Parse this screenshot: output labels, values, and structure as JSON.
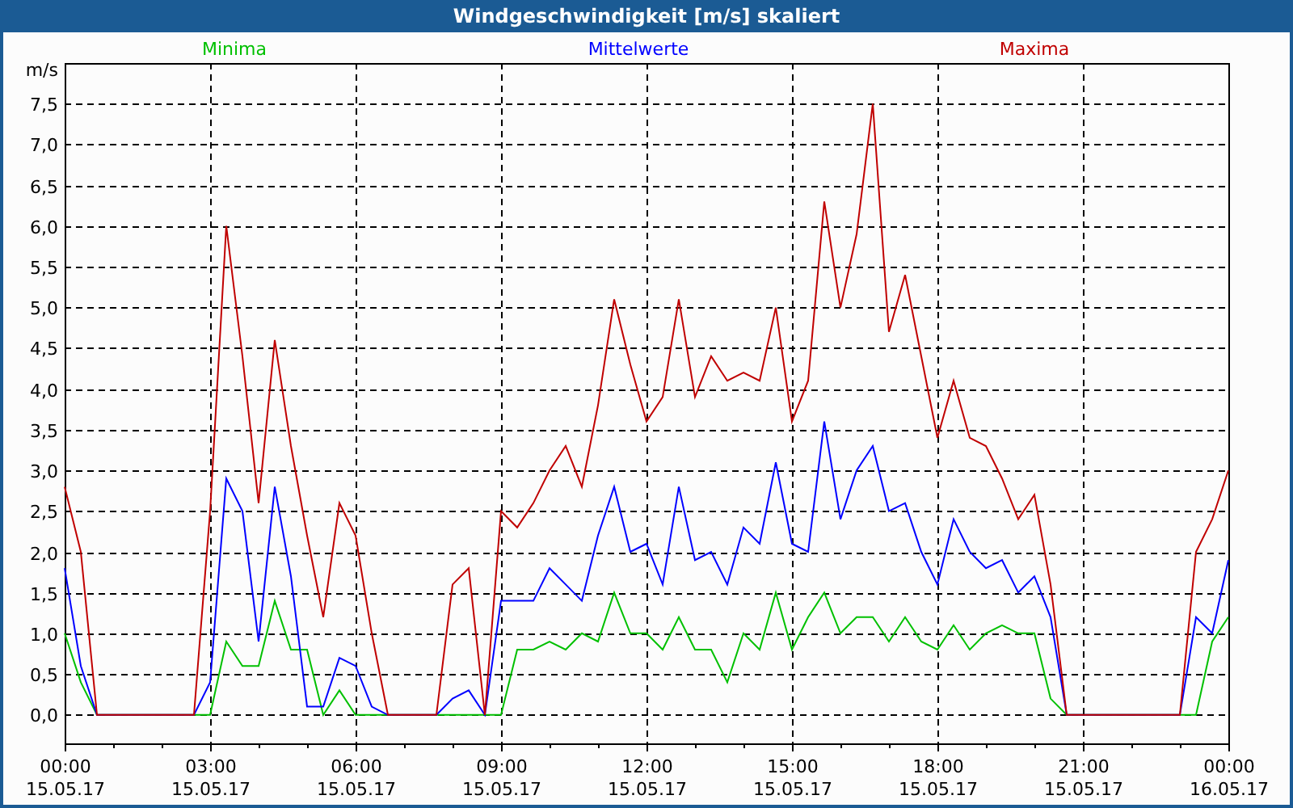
{
  "window": {
    "title": "Windgeschwindigkeit [m/s] skaliert"
  },
  "chart": {
    "chart_data": {
      "type": "line",
      "grid": true,
      "ylabel": "m/s",
      "ylim": [
        -0.35,
        8.0
      ],
      "categories": [
        "00:00 15.05.17",
        null,
        null,
        null,
        null,
        null,
        null,
        null,
        null,
        "03:00 15.05.17",
        null,
        null,
        null,
        null,
        null,
        null,
        null,
        null,
        "06:00 15.05.17",
        null,
        null,
        null,
        null,
        null,
        null,
        null,
        null,
        "09:00 15.05.17",
        null,
        null,
        null,
        null,
        null,
        null,
        null,
        null,
        "12:00 15.05.17",
        null,
        null,
        null,
        null,
        null,
        null,
        null,
        null,
        "15:00 15.05.17",
        null,
        null,
        null,
        null,
        null,
        null,
        null,
        null,
        "18:00 15.05.17",
        null,
        null,
        null,
        null,
        null,
        null,
        null,
        null,
        "21:00 15.05.17",
        null,
        null,
        null,
        null,
        null,
        null,
        null,
        null,
        "00:00 16.05.17"
      ],
      "series": [
        {
          "name": "Minima",
          "color": "#00c000",
          "values": [
            1.0,
            0.4,
            0,
            0,
            0,
            0,
            0,
            0,
            0,
            0,
            0.9,
            0.6,
            0.6,
            1.4,
            0.8,
            0.8,
            0,
            0.3,
            0,
            0,
            0,
            0,
            0,
            0,
            0,
            0,
            0,
            0,
            0.8,
            0.8,
            0.9,
            0.8,
            1.0,
            0.9,
            1.5,
            1.0,
            1.0,
            0.8,
            1.2,
            0.8,
            0.8,
            0.4,
            1.0,
            0.8,
            1.5,
            0.8,
            1.2,
            1.5,
            1.0,
            1.2,
            1.2,
            0.9,
            1.2,
            0.9,
            0.8,
            1.1,
            0.8,
            1.0,
            1.1,
            1.0,
            1.0,
            0.2,
            0,
            0,
            0,
            0,
            0,
            0,
            0,
            0,
            0,
            0.9,
            1.2
          ]
        },
        {
          "name": "Mittelwerte",
          "color": "#0000ff",
          "values": [
            1.8,
            0.6,
            0,
            0,
            0,
            0,
            0,
            0,
            0,
            0.4,
            2.9,
            2.5,
            0.9,
            2.8,
            1.7,
            0.1,
            0.1,
            0.7,
            0.6,
            0.1,
            0,
            0,
            0,
            0,
            0.2,
            0.3,
            0,
            1.4,
            1.4,
            1.4,
            1.8,
            1.6,
            1.4,
            2.2,
            2.8,
            2.0,
            2.1,
            1.6,
            2.8,
            1.9,
            2.0,
            1.6,
            2.3,
            2.1,
            3.1,
            2.1,
            2.0,
            3.6,
            2.4,
            3.0,
            3.3,
            2.5,
            2.6,
            2.0,
            1.6,
            2.4,
            2.0,
            1.8,
            1.9,
            1.5,
            1.7,
            1.2,
            0,
            0,
            0,
            0,
            0,
            0,
            0,
            0,
            1.2,
            1.0,
            1.9
          ]
        },
        {
          "name": "Maxima",
          "color": "#c00000",
          "values": [
            2.8,
            2.0,
            0,
            0,
            0,
            0,
            0,
            0,
            0,
            2.5,
            6.0,
            4.4,
            2.6,
            4.6,
            3.3,
            2.2,
            1.2,
            2.6,
            2.2,
            1.0,
            0,
            0,
            0,
            0,
            1.6,
            1.8,
            0,
            2.5,
            2.3,
            2.6,
            3.0,
            3.3,
            2.8,
            3.8,
            5.1,
            4.3,
            3.6,
            3.9,
            5.1,
            3.9,
            4.4,
            4.1,
            4.2,
            4.1,
            5.0,
            3.6,
            4.1,
            6.3,
            5.0,
            5.9,
            7.5,
            4.7,
            5.4,
            4.4,
            3.4,
            4.1,
            3.4,
            3.3,
            2.9,
            2.4,
            2.7,
            1.6,
            0,
            0,
            0,
            0,
            0,
            0,
            0,
            0,
            2.0,
            2.4,
            3.0
          ]
        }
      ],
      "yticks": [
        {
          "value": 0,
          "label": "0,0"
        },
        {
          "value": 0.5,
          "label": "0,5"
        },
        {
          "value": 1,
          "label": "1,0"
        },
        {
          "value": 1.5,
          "label": "1,5"
        },
        {
          "value": 2,
          "label": "2,0"
        },
        {
          "value": 2.5,
          "label": "2,5"
        },
        {
          "value": 3,
          "label": "3,0"
        },
        {
          "value": 3.5,
          "label": "3,5"
        },
        {
          "value": 4,
          "label": "4,0"
        },
        {
          "value": 4.5,
          "label": "4,5"
        },
        {
          "value": 5,
          "label": "5,0"
        },
        {
          "value": 5.5,
          "label": "5,5"
        },
        {
          "value": 6,
          "label": "6,0"
        },
        {
          "value": 6.5,
          "label": "6,5"
        },
        {
          "value": 7,
          "label": "7,0"
        },
        {
          "value": 7.5,
          "label": "7,5"
        }
      ]
    }
  }
}
